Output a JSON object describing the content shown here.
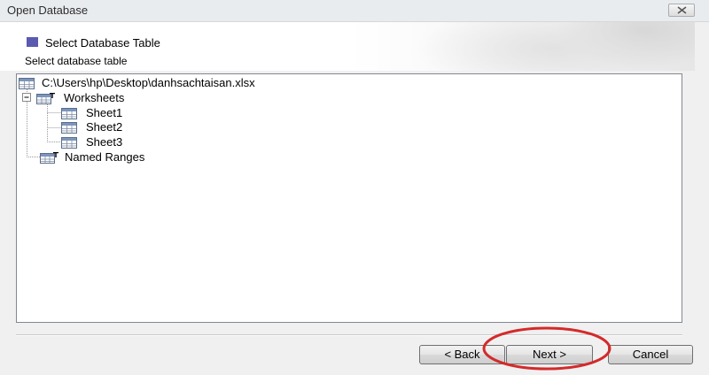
{
  "window": {
    "title": "Open Database"
  },
  "header": {
    "title": "Select Database Table",
    "subtitle": "Select database table"
  },
  "tree": {
    "root": "C:\\Users\\hp\\Desktop\\danhsachtaisan.xlsx",
    "worksheets_label": "Worksheets",
    "sheets": [
      "Sheet1",
      "Sheet2",
      "Sheet3"
    ],
    "named_ranges_label": "Named Ranges"
  },
  "buttons": {
    "back": "< Back",
    "next": "Next >",
    "cancel": "Cancel"
  },
  "annotation": {
    "highlight_color": "#d42a2a",
    "highlight_target": "Next >"
  },
  "colors": {
    "header_square": "#5a5ab0",
    "tree_border": "#828790",
    "window_bg": "#f0f0f0"
  },
  "icons": [
    "close-icon",
    "table-icon",
    "minus-expander-icon",
    "folder-table-icon"
  ]
}
